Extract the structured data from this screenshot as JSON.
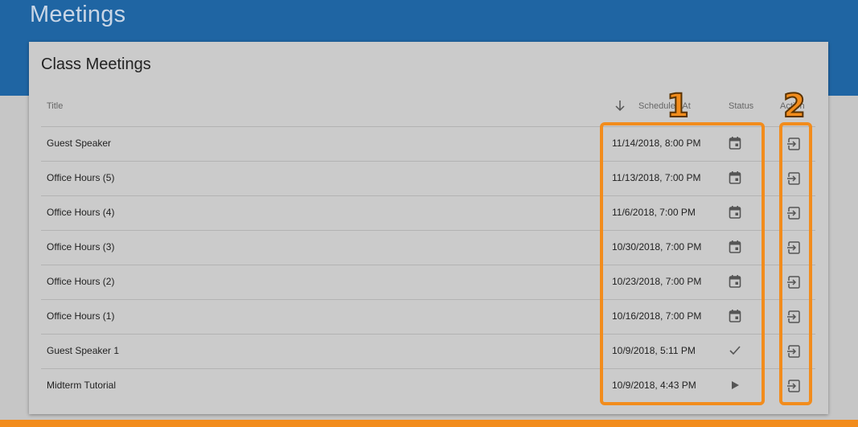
{
  "app": {
    "title": "Meetings"
  },
  "card": {
    "title": "Class Meetings",
    "columns": {
      "title": "Title",
      "scheduled_at": "Scheduled At",
      "status": "Status",
      "action": "Action"
    }
  },
  "rows": [
    {
      "title": "Guest Speaker",
      "date": "11/14/2018, 8:00 PM",
      "status_icon": "calendar-icon"
    },
    {
      "title": "Office Hours (5)",
      "date": "11/13/2018, 7:00 PM",
      "status_icon": "calendar-icon"
    },
    {
      "title": "Office Hours (4)",
      "date": "11/6/2018, 7:00 PM",
      "status_icon": "calendar-icon"
    },
    {
      "title": "Office Hours (3)",
      "date": "10/30/2018, 7:00 PM",
      "status_icon": "calendar-icon"
    },
    {
      "title": "Office Hours (2)",
      "date": "10/23/2018, 7:00 PM",
      "status_icon": "calendar-icon"
    },
    {
      "title": "Office Hours (1)",
      "date": "10/16/2018, 7:00 PM",
      "status_icon": "calendar-icon"
    },
    {
      "title": "Guest Speaker 1",
      "date": "10/9/2018, 5:11 PM",
      "status_icon": "check-icon"
    },
    {
      "title": "Midterm Tutorial",
      "date": "10/9/2018, 4:43 PM",
      "status_icon": "play-icon"
    }
  ],
  "annotations": {
    "callout_1": "1",
    "callout_2": "2"
  },
  "colors": {
    "appbar": "#1f65a3",
    "highlight": "#f28c1c"
  }
}
